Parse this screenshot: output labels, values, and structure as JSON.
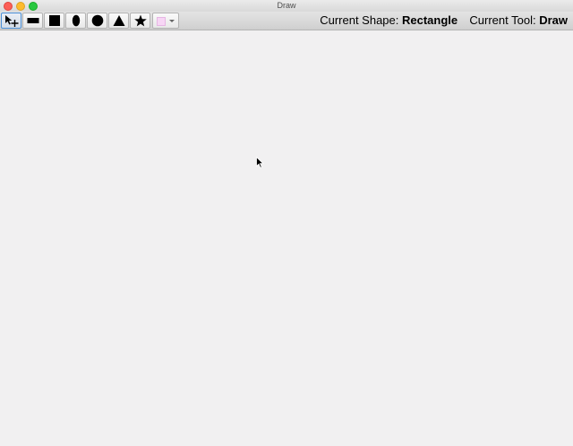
{
  "window": {
    "title": "Draw"
  },
  "toolbar": {
    "tools": [
      {
        "name": "select-tool",
        "icon": "arrow-move-icon",
        "selected": true
      },
      {
        "name": "rectangle-tool",
        "icon": "rectangle-icon",
        "selected": false
      },
      {
        "name": "square-tool",
        "icon": "square-icon",
        "selected": false
      },
      {
        "name": "ellipse-tool",
        "icon": "ellipse-icon",
        "selected": false
      },
      {
        "name": "circle-tool",
        "icon": "circle-icon",
        "selected": false
      },
      {
        "name": "triangle-tool",
        "icon": "triangle-icon",
        "selected": false
      },
      {
        "name": "star-tool",
        "icon": "star-icon",
        "selected": false
      }
    ],
    "color_picker": {
      "color": "#f7d6f5",
      "icon": "chevron-down-icon"
    }
  },
  "status": {
    "shape_label": "Current Shape:",
    "shape_value": "Rectangle",
    "tool_label": "Current Tool:",
    "tool_value": "Draw"
  },
  "colors": {
    "selection_accent": "#4a8fd7",
    "canvas": "#f1f0f1"
  }
}
